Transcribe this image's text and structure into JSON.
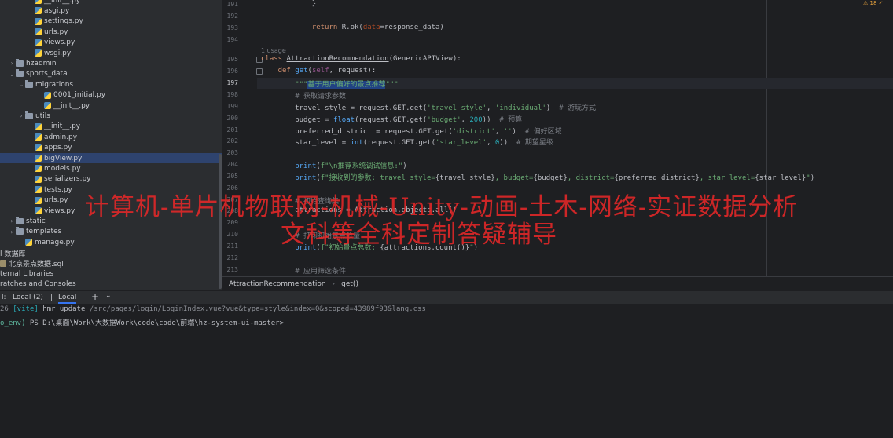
{
  "tree": {
    "items": [
      {
        "label": "__init__.py",
        "icon": "python-file-icon",
        "indent": 3,
        "arrow": ""
      },
      {
        "label": "asgi.py",
        "icon": "python-file-icon",
        "indent": 3,
        "arrow": ""
      },
      {
        "label": "settings.py",
        "icon": "python-file-icon",
        "indent": 3,
        "arrow": ""
      },
      {
        "label": "urls.py",
        "icon": "python-file-icon",
        "indent": 3,
        "arrow": ""
      },
      {
        "label": "views.py",
        "icon": "python-file-icon",
        "indent": 3,
        "arrow": ""
      },
      {
        "label": "wsgi.py",
        "icon": "python-file-icon",
        "indent": 3,
        "arrow": ""
      },
      {
        "label": "hzadmin",
        "icon": "folder-icon",
        "indent": 1,
        "arrow": "›"
      },
      {
        "label": "sports_data",
        "icon": "folder-icon",
        "indent": 1,
        "arrow": "⌄"
      },
      {
        "label": "migrations",
        "icon": "folder-icon",
        "indent": 2,
        "arrow": "⌄"
      },
      {
        "label": "0001_initial.py",
        "icon": "python-file-icon",
        "indent": 4,
        "arrow": ""
      },
      {
        "label": "__init__.py",
        "icon": "python-file-icon",
        "indent": 4,
        "arrow": ""
      },
      {
        "label": "utils",
        "icon": "folder-icon",
        "indent": 2,
        "arrow": "›"
      },
      {
        "label": "__init__.py",
        "icon": "python-file-icon",
        "indent": 3,
        "arrow": ""
      },
      {
        "label": "admin.py",
        "icon": "python-file-icon",
        "indent": 3,
        "arrow": ""
      },
      {
        "label": "apps.py",
        "icon": "python-file-icon",
        "indent": 3,
        "arrow": ""
      },
      {
        "label": "bigView.py",
        "icon": "python-file-icon",
        "indent": 3,
        "arrow": "",
        "selected": true
      },
      {
        "label": "models.py",
        "icon": "python-file-icon",
        "indent": 3,
        "arrow": ""
      },
      {
        "label": "serializers.py",
        "icon": "python-file-icon",
        "indent": 3,
        "arrow": ""
      },
      {
        "label": "tests.py",
        "icon": "python-file-icon",
        "indent": 3,
        "arrow": ""
      },
      {
        "label": "urls.py",
        "icon": "python-file-icon",
        "indent": 3,
        "arrow": ""
      },
      {
        "label": "views.py",
        "icon": "python-file-icon",
        "indent": 3,
        "arrow": ""
      },
      {
        "label": "static",
        "icon": "folder-icon",
        "indent": 1,
        "arrow": "›"
      },
      {
        "label": "templates",
        "icon": "folder-icon",
        "indent": 1,
        "arrow": "›"
      },
      {
        "label": "manage.py",
        "icon": "python-file-icon",
        "indent": 2,
        "arrow": ""
      },
      {
        "label": "l 数据库",
        "icon": "",
        "indent": 0,
        "arrow": ""
      },
      {
        "label": "北京景点数据.sql",
        "icon": "sql-file-icon",
        "indent": 0,
        "arrow": ""
      },
      {
        "label": "ternal Libraries",
        "icon": "",
        "indent": 0,
        "arrow": ""
      },
      {
        "label": "ratches and Consoles",
        "icon": "",
        "indent": 0,
        "arrow": ""
      }
    ]
  },
  "editor": {
    "usage_hint": "1 usage",
    "lines": [
      {
        "n": "191",
        "indent": 6,
        "tokens": [
          [
            "}",
            ""
          ]
        ]
      },
      {
        "n": "192",
        "indent": 0,
        "tokens": []
      },
      {
        "n": "193",
        "indent": 6,
        "tokens": [
          [
            "return ",
            "kw"
          ],
          [
            "R.ok(",
            ""
          ],
          [
            "data",
            "param"
          ],
          [
            "=response_data)",
            ""
          ]
        ]
      },
      {
        "n": "194",
        "indent": 0,
        "tokens": []
      },
      {
        "n": "195",
        "indent": 0,
        "tokens": [
          [
            "class ",
            "kw"
          ],
          [
            "AttractionRecommendation",
            "clsname"
          ],
          [
            "(GenericAPIView):",
            ""
          ]
        ]
      },
      {
        "n": "196",
        "indent": 2,
        "tokens": [
          [
            "def ",
            "kw"
          ],
          [
            "get",
            "fn"
          ],
          [
            "(",
            ""
          ],
          [
            "self",
            "self"
          ],
          [
            ", request):",
            ""
          ]
        ]
      },
      {
        "n": "197",
        "indent": 4,
        "tokens": [
          [
            "\"\"\"",
            "str"
          ],
          [
            "基于用户偏好的景点推荐",
            "strsel"
          ],
          [
            "\"\"\"",
            "str"
          ]
        ],
        "current": true
      },
      {
        "n": "198",
        "indent": 4,
        "tokens": [
          [
            "# 获取请求参数",
            "cmt"
          ]
        ]
      },
      {
        "n": "199",
        "indent": 4,
        "tokens": [
          [
            "travel_style = request.GET.get(",
            ""
          ],
          [
            "'travel_style'",
            "str"
          ],
          [
            ", ",
            ""
          ],
          [
            "'individual'",
            "str"
          ],
          [
            ")  ",
            ""
          ],
          [
            "# 游玩方式",
            "cmt"
          ]
        ]
      },
      {
        "n": "200",
        "indent": 4,
        "tokens": [
          [
            "budget = ",
            ""
          ],
          [
            "float",
            "fn"
          ],
          [
            "(request.GET.get(",
            ""
          ],
          [
            "'budget'",
            "str"
          ],
          [
            ", ",
            ""
          ],
          [
            "200",
            "num"
          ],
          [
            "))  ",
            ""
          ],
          [
            "# 预算",
            "cmt"
          ]
        ]
      },
      {
        "n": "201",
        "indent": 4,
        "tokens": [
          [
            "preferred_district = request.GET.get(",
            ""
          ],
          [
            "'district'",
            "str"
          ],
          [
            ", ",
            ""
          ],
          [
            "''",
            "str"
          ],
          [
            ")  ",
            ""
          ],
          [
            "# 偏好区域",
            "cmt"
          ]
        ]
      },
      {
        "n": "202",
        "indent": 4,
        "tokens": [
          [
            "star_level = ",
            ""
          ],
          [
            "int",
            "fn"
          ],
          [
            "(request.GET.get(",
            ""
          ],
          [
            "'star_level'",
            "str"
          ],
          [
            ", ",
            ""
          ],
          [
            "0",
            "num"
          ],
          [
            "))  ",
            ""
          ],
          [
            "# 期望星级",
            "cmt"
          ]
        ]
      },
      {
        "n": "203",
        "indent": 0,
        "tokens": []
      },
      {
        "n": "204",
        "indent": 4,
        "tokens": [
          [
            "print",
            "fn"
          ],
          [
            "(",
            ""
          ],
          [
            "f\"\\n推荐系统调试信息:\"",
            "str"
          ],
          [
            ")",
            ""
          ]
        ]
      },
      {
        "n": "205",
        "indent": 4,
        "tokens": [
          [
            "print",
            "fn"
          ],
          [
            "(",
            ""
          ],
          [
            "f\"接收到的参数: travel_style=",
            "str"
          ],
          [
            "{travel_style}",
            ""
          ],
          [
            ", budget=",
            "str"
          ],
          [
            "{budget}",
            ""
          ],
          [
            ", district=",
            "str"
          ],
          [
            "{preferred_district}",
            ""
          ],
          [
            ", star_level=",
            "str"
          ],
          [
            "{star_level}",
            ""
          ],
          [
            "\"",
            "str"
          ],
          [
            ")",
            ""
          ]
        ]
      },
      {
        "n": "206",
        "indent": 0,
        "tokens": []
      },
      {
        "n": "207",
        "indent": 4,
        "tokens": [
          [
            "# 初始查询集",
            "cmt"
          ]
        ]
      },
      {
        "n": "208",
        "indent": 4,
        "tokens": [
          [
            "attractions = Attraction.objects.all()",
            ""
          ]
        ]
      },
      {
        "n": "209",
        "indent": 0,
        "tokens": []
      },
      {
        "n": "210",
        "indent": 4,
        "tokens": [
          [
            "# 打印初始景点数量",
            "cmt"
          ]
        ]
      },
      {
        "n": "211",
        "indent": 4,
        "tokens": [
          [
            "print",
            "fn"
          ],
          [
            "(",
            ""
          ],
          [
            "f\"初始景点总数: ",
            "str"
          ],
          [
            "{attractions.count()}",
            ""
          ],
          [
            "\"",
            "str"
          ],
          [
            ")",
            ""
          ]
        ]
      },
      {
        "n": "212",
        "indent": 0,
        "tokens": []
      },
      {
        "n": "213",
        "indent": 4,
        "tokens": [
          [
            "# 应用筛选条件",
            "cmt"
          ]
        ]
      }
    ],
    "breadcrumb": [
      "AttractionRecommendation",
      "get()"
    ]
  },
  "terminal": {
    "tabs": [
      "Local (2)",
      "Local"
    ],
    "add_label": "+",
    "dropdown_label": "⌄",
    "prefix_label": "l:",
    "lines": [
      {
        "parts": [
          [
            "26 ",
            "t-gray"
          ],
          [
            "[vite]",
            "t-cyan"
          ],
          [
            " hmr update ",
            ""
          ],
          [
            "/src/pages/login/LoginIndex.vue?vue&type=style&index=0&scoped=43989f93&lang.css",
            "t-gray"
          ]
        ]
      },
      {
        "parts": [
          [
            "o_env)",
            "t-green"
          ],
          [
            " PS D:\\桌面\\Work\\大数据Work\\code\\code\\前端\\hz-system-ui-master> ",
            ""
          ]
        ]
      }
    ]
  },
  "top_right": "⚠ 18 ✓",
  "watermark": {
    "line1": "计算机-单片机物联网-机械-Unity-动画-土木-网络-实证数据分析",
    "line2": "文科等全科定制答疑辅导"
  },
  "colors": {
    "background": "#1e1f22",
    "sidebar": "#2b2d30",
    "selection": "#2e436e",
    "watermark": "#e62828",
    "accent": "#3574f0"
  }
}
